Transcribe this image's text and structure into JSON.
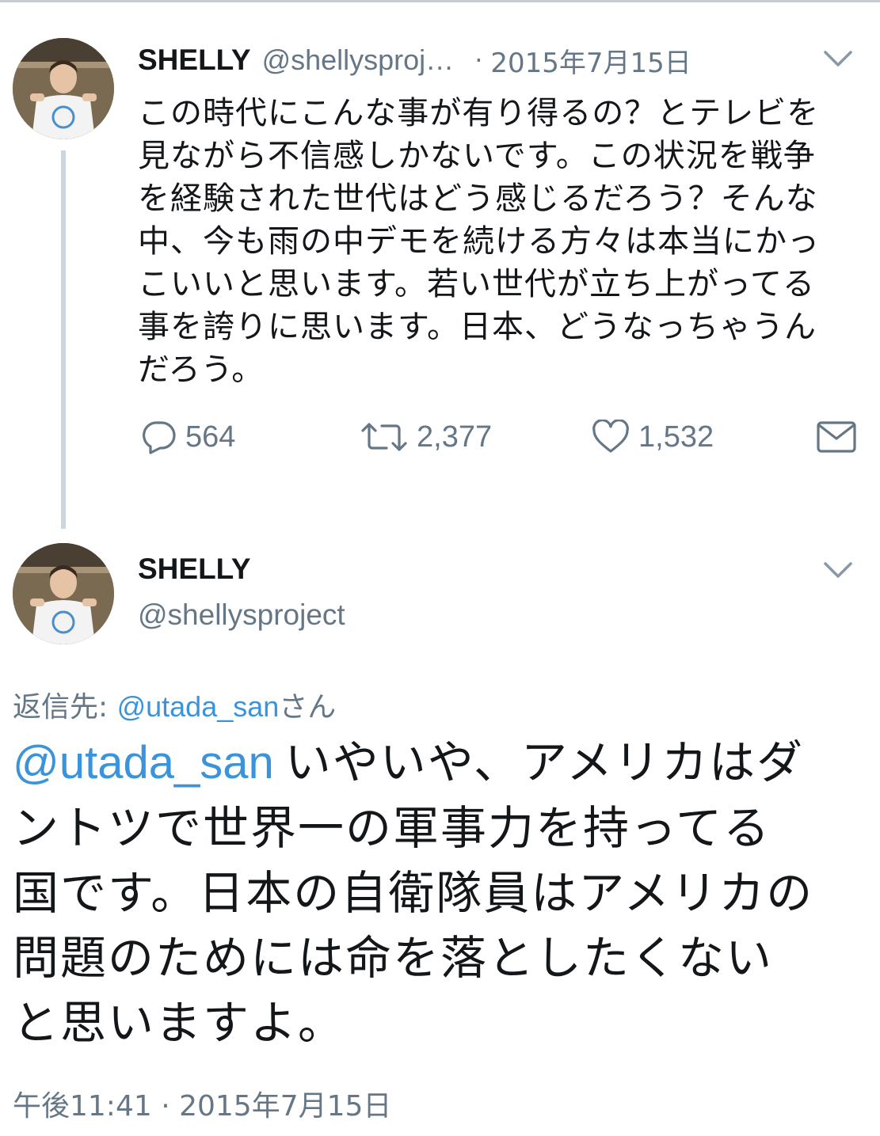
{
  "tweet1": {
    "name": "SHELLY",
    "handle": "@shellysproj…",
    "separator": "·",
    "date": "2015年7月15日",
    "menu_icon": "chevron-down-icon",
    "body_lines": [
      "この時代にこんな事が有り得るの？とテレビを",
      "見ながら不信感しかないです。この状況を戦争",
      "を経験された世代はどう感じるだろう？そんな",
      "中、今も雨の中デモを続ける方々は本当にかっ",
      "こいいと思います。若い世代が立ち上がってる",
      "事を誇りに思います。日本、どうなっちゃうん",
      "だろう。"
    ],
    "actions": {
      "replies": "564",
      "retweets": "2,377",
      "likes": "1,532"
    }
  },
  "tweet2": {
    "name": "SHELLY",
    "handle": "@shellysproject",
    "menu_icon": "chevron-down-icon",
    "replying_prefix": "返信先: ",
    "replying_to": "@utada_san",
    "replying_suffix": "さん",
    "mention": "@utada_san",
    "body_lines": [
      "いやいや、アメリカはダ",
      "ントツで世界一の軍事力を持ってる",
      "国です。日本の自衛隊員はアメリカの",
      "問題のためには命を落としたくない",
      "と思いますよ。"
    ],
    "timestamp": "午後11:41 · 2015年7月15日"
  },
  "colors": {
    "link": "#3b94d9",
    "secondary_text": "#657786",
    "primary_text": "#14171a",
    "thread_line": "#ccd6dd"
  }
}
